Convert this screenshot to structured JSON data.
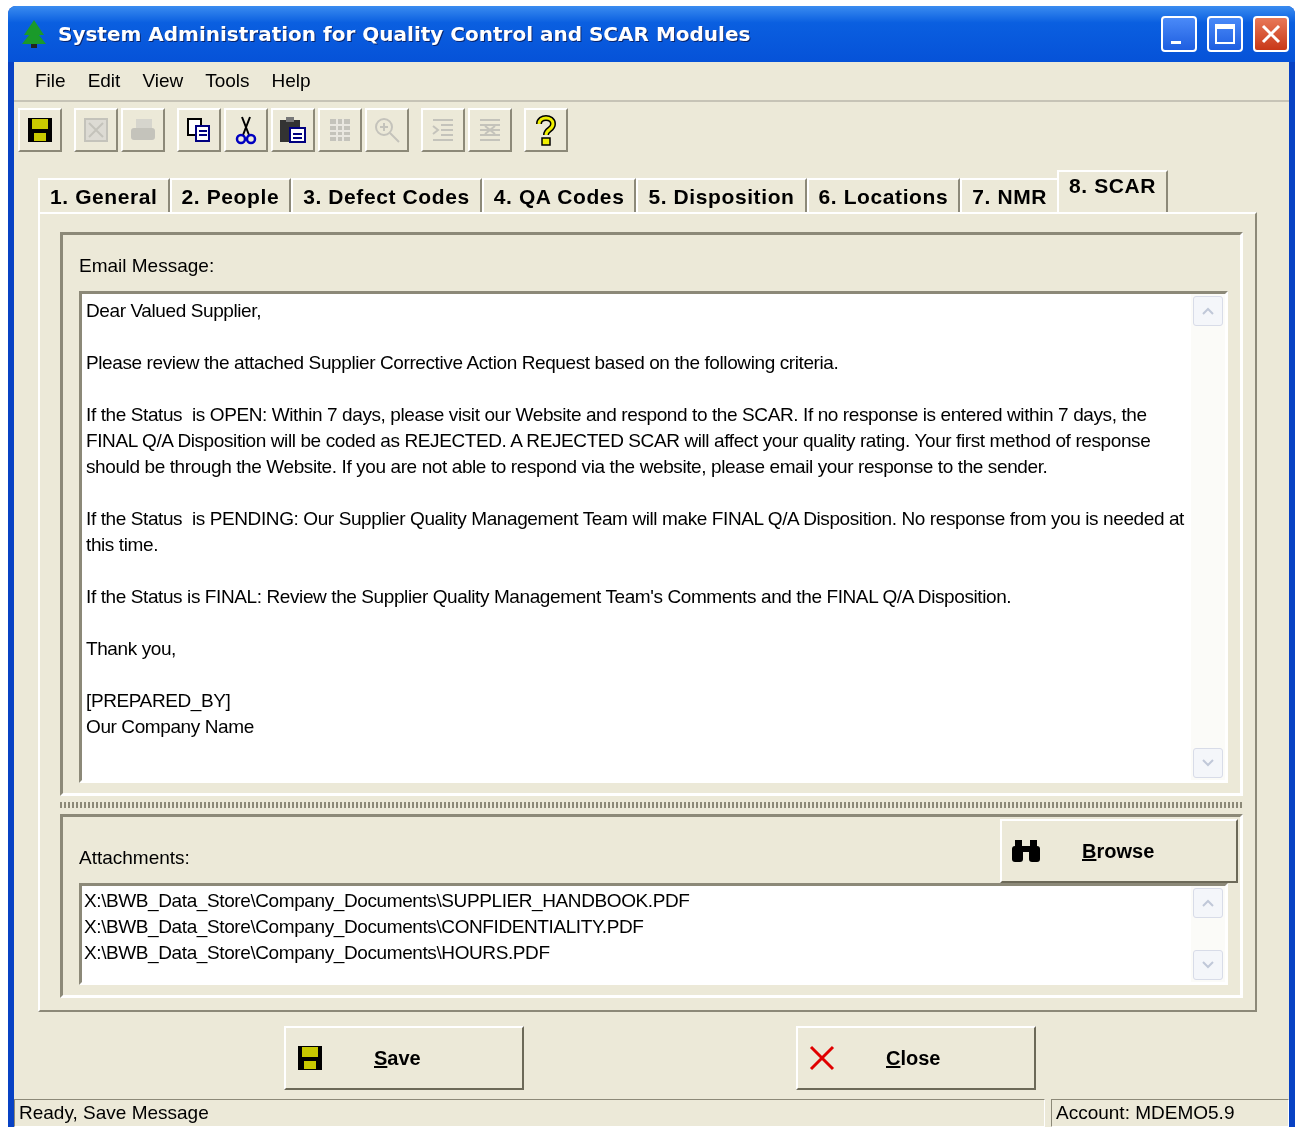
{
  "window": {
    "title": "System Administration for Quality Control and SCAR Modules"
  },
  "menu": [
    "File",
    "Edit",
    "View",
    "Tools",
    "Help"
  ],
  "toolbar": [
    {
      "kind": "save",
      "disabled": false
    },
    {
      "kind": "excel",
      "disabled": true
    },
    {
      "kind": "print",
      "disabled": true
    },
    {
      "kind": "copy",
      "disabled": false
    },
    {
      "kind": "cut",
      "disabled": false
    },
    {
      "kind": "paste",
      "disabled": false
    },
    {
      "kind": "grid",
      "disabled": true
    },
    {
      "kind": "zoom",
      "disabled": true
    },
    {
      "kind": "indent",
      "disabled": true
    },
    {
      "kind": "outdent",
      "disabled": true
    },
    {
      "kind": "help",
      "disabled": false
    }
  ],
  "tabs": [
    {
      "label": "1. General",
      "selected": false
    },
    {
      "label": "2. People",
      "selected": false
    },
    {
      "label": "3. Defect Codes",
      "selected": false
    },
    {
      "label": "4. QA Codes",
      "selected": false
    },
    {
      "label": "5. Disposition",
      "selected": false
    },
    {
      "label": "6. Locations",
      "selected": false
    },
    {
      "label": "7. NMR",
      "selected": false
    },
    {
      "label": "8. SCAR",
      "selected": true
    }
  ],
  "email": {
    "label": "Email Message:",
    "paragraphs": [
      [
        "Dear Valued Supplier,"
      ],
      [
        "Please review the attached Supplier Corrective Action Request based on the following criteria."
      ],
      [
        "If the Status  is OPEN: Within 7 days, please visit our Website and respond to the SCAR. If no response is entered within 7 days, the FINAL Q/A Disposition will be coded as REJECTED. A REJECTED SCAR will affect your quality rating. Your first method of response should be through the Website. If you are not able to respond via the website, please email your response to the sender."
      ],
      [
        "If the Status  is PENDING: Our Supplier Quality Management Team will make FINAL Q/A Disposition. No response from you is needed at this time."
      ],
      [
        "If the Status is FINAL: Review the Supplier Quality Management Team's Comments and the FINAL Q/A Disposition."
      ],
      [
        "Thank you,"
      ],
      [
        "[PREPARED_BY]",
        "Our Company Name"
      ]
    ]
  },
  "attachments": {
    "label": "Attachments:",
    "browse": "Browse",
    "files": [
      "X:\\BWB_Data_Store\\Company_Documents\\SUPPLIER_HANDBOOK.PDF",
      "X:\\BWB_Data_Store\\Company_Documents\\CONFIDENTIALITY.PDF",
      "X:\\BWB_Data_Store\\Company_Documents\\HOURS.PDF"
    ]
  },
  "buttons": [
    {
      "kind": "save",
      "label": "Save"
    },
    {
      "kind": "close",
      "label": "Close"
    }
  ],
  "status_bar": {
    "message": "Ready, Save Message",
    "account": "Account: MDEMO5.9"
  }
}
